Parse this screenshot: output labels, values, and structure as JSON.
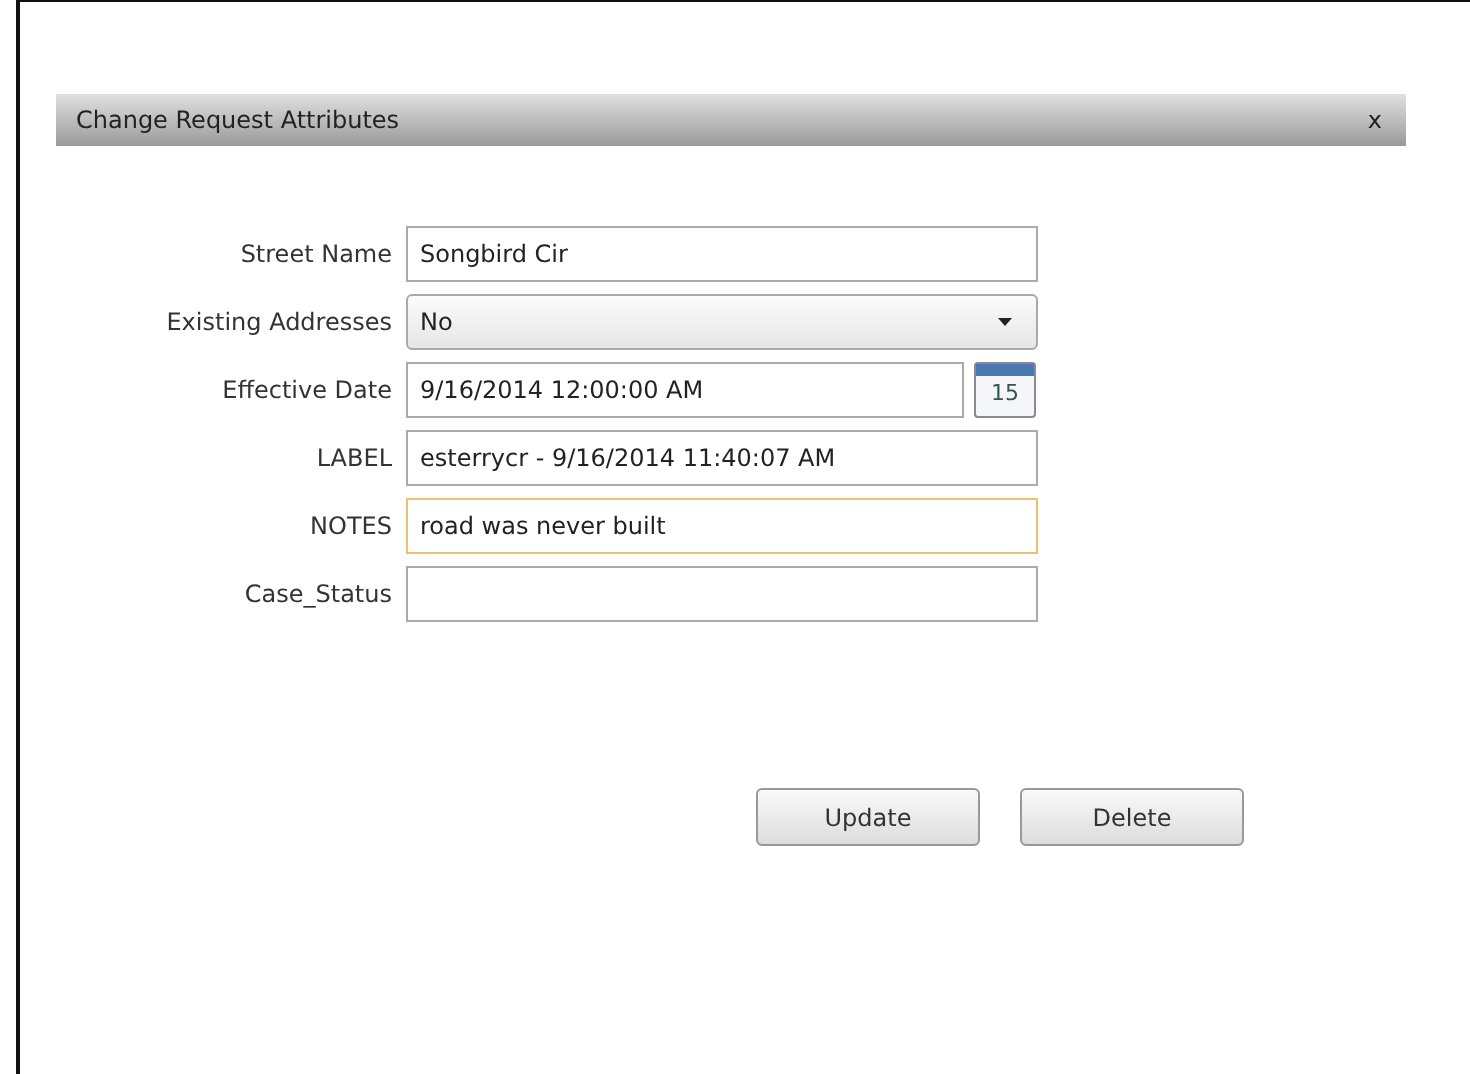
{
  "dialog": {
    "title": "Change Request Attributes",
    "close": "x"
  },
  "fields": [
    {
      "label": "Street Name",
      "kind": "text",
      "value": "Songbird Cir",
      "focused": false
    },
    {
      "label": "Existing Addresses",
      "kind": "select",
      "value": "No",
      "focused": false
    },
    {
      "label": "Effective Date",
      "kind": "date",
      "value": "9/16/2014 12:00:00 AM",
      "focused": false,
      "calendar_day": "15"
    },
    {
      "label": "LABEL",
      "kind": "text",
      "value": "esterrycr - 9/16/2014 11:40:07 AM",
      "focused": false
    },
    {
      "label": "NOTES",
      "kind": "text",
      "value": "road was never built",
      "focused": true
    },
    {
      "label": "Case_Status",
      "kind": "text",
      "focused": false
    }
  ],
  "buttons": [
    "Update",
    "Delete"
  ]
}
